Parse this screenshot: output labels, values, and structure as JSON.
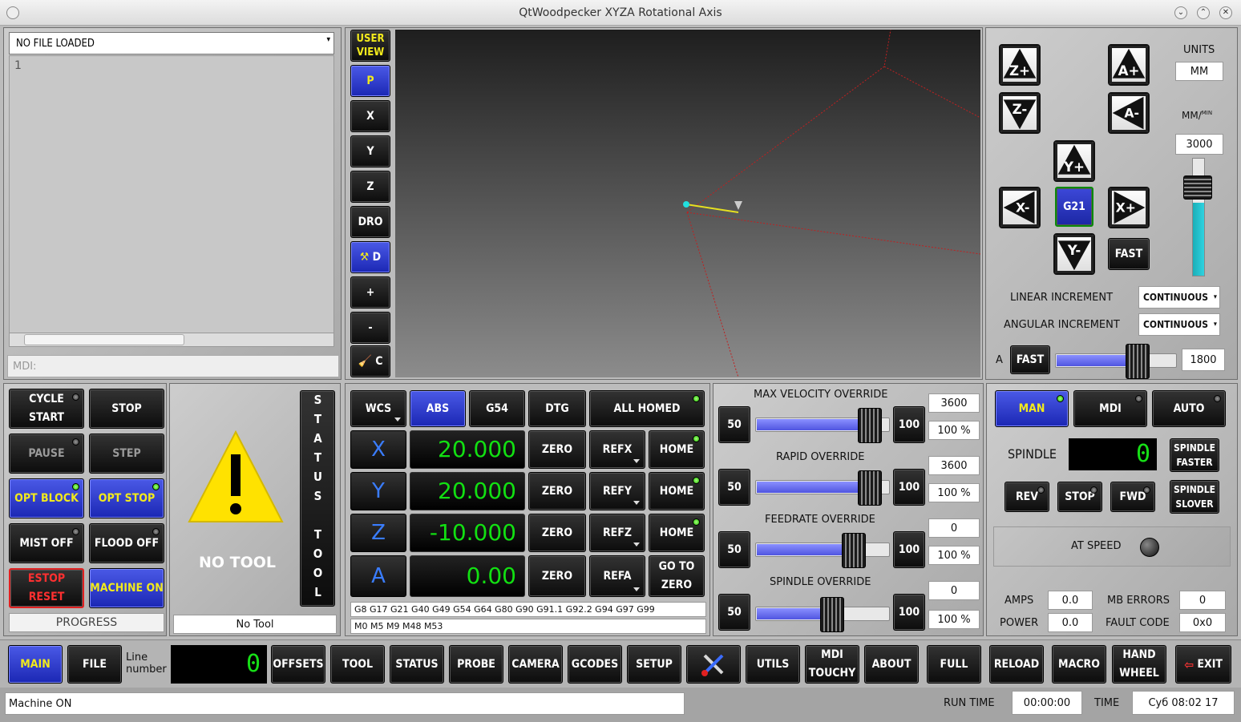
{
  "window": {
    "title": "QtWoodpecker XYZA Rotational Axis",
    "btn_min": "⌄",
    "btn_max": "⌃",
    "btn_close": "✕"
  },
  "editor": {
    "file_select": "NO FILE LOADED",
    "line_no": "1",
    "mdi_placeholder": "MDI:"
  },
  "viewer": {
    "user_view": "USER VIEW",
    "views": [
      "P",
      "X",
      "Y",
      "Z",
      "DRO",
      "D",
      "+",
      "-",
      "C"
    ]
  },
  "jog": {
    "units_label": "UNITS",
    "units": "MM",
    "feed_unit": "MM/",
    "feed_unit_sup": "MIN",
    "feed_rate": "3000",
    "g21": "G21",
    "fast": "FAST",
    "linear_inc_label": "LINEAR INCREMENT",
    "linear_inc": "CONTINUOUS",
    "angular_inc_label": "ANGULAR INCREMENT",
    "angular_inc": "CONTINUOUS",
    "a_label": "A",
    "a_fast": "FAST",
    "a_rate": "1800",
    "jog_level": 0.62,
    "a_level": 0.4,
    "labels": {
      "zp": "Z+",
      "zm": "Z-",
      "ap": "A+",
      "am": "A-",
      "yp": "Y+",
      "ym": "Y-",
      "xp": "X+",
      "xm": "X-"
    }
  },
  "controls": {
    "cycle_start": "CYCLE START",
    "stop": "STOP",
    "pause": "PAUSE",
    "step": "STEP",
    "opt_block": "OPT BLOCK",
    "opt_stop": "OPT STOP",
    "mist": "MIST OFF",
    "flood": "FLOOD OFF",
    "estop": "ESTOP RESET",
    "machine": "MACHINE ON",
    "progress": "PROGRESS"
  },
  "tool": {
    "no_tool": "NO TOOL",
    "status_tool": "STATUS TOOL",
    "tool_field": "No Tool"
  },
  "dro": {
    "wcs": "WCS",
    "abs": "ABS",
    "g54": "G54",
    "dtg": "DTG",
    "all_homed": "ALL HOMED",
    "axes": [
      {
        "name": "X",
        "value": "20.000",
        "ref": "REFX",
        "home": "HOME"
      },
      {
        "name": "Y",
        "value": "20.000",
        "ref": "REFY",
        "home": "HOME"
      },
      {
        "name": "Z",
        "value": "-10.000",
        "ref": "REFZ",
        "home": "HOME"
      },
      {
        "name": "A",
        "value": "0.00",
        "ref": "REFA",
        "home": "GO TO ZERO"
      }
    ],
    "zero": "ZERO",
    "gcodes": "G8 G17 G21 G40 G49 G54 G64 G80 G90 G91.1 G92.2 G94 G97 G99",
    "mcodes": "M0 M5 M9 M48 M53"
  },
  "overrides": [
    {
      "title": "MAX VELOCITY OVERRIDE",
      "value": "3600",
      "percent": "100 %",
      "level": 0.95,
      "low": "50",
      "high": "100"
    },
    {
      "title": "RAPID OVERRIDE",
      "value": "3600",
      "percent": "100 %",
      "level": 0.95,
      "low": "50",
      "high": "100"
    },
    {
      "title": "FEEDRATE OVERRIDE",
      "value": "0",
      "percent": "100 %",
      "level": 0.8,
      "low": "50",
      "high": "100"
    },
    {
      "title": "SPINDLE OVERRIDE",
      "value": "0",
      "percent": "100 %",
      "level": 0.6,
      "low": "50",
      "high": "100"
    }
  ],
  "spindle": {
    "man": "MAN",
    "mdi": "MDI",
    "auto": "AUTO",
    "label": "SPINDLE",
    "speed": "0",
    "faster": "SPINDLE FASTER",
    "rev": "REV",
    "stop": "STOP",
    "fwd": "FWD",
    "slower": "SPINDLE SLOVER",
    "at_speed": "AT SPEED",
    "amps_label": "AMPS",
    "amps": "0.0",
    "mb_errors_label": "MB ERRORS",
    "mb_errors": "0",
    "power_label": "POWER",
    "power": "0.0",
    "fault_label": "FAULT CODE",
    "fault": "0x0"
  },
  "tabs": {
    "main": "MAIN",
    "file": "FILE",
    "line_number_label": "Line number",
    "line_number": "0",
    "offsets": "OFFSETS",
    "tool": "TOOL",
    "status": "STATUS",
    "probe": "PROBE",
    "camera": "CAMERA",
    "gcodes": "GCODES",
    "setup": "SETUP",
    "utils": "UTILS",
    "mdi_touchy": "MDI TOUCHY",
    "about": "ABOUT",
    "full": "FULL",
    "reload": "RELOAD",
    "macro": "MACRO",
    "hand_wheel": "HAND WHEEL",
    "exit": "EXIT"
  },
  "status": {
    "message": "Machine ON",
    "run_time_label": "RUN TIME",
    "run_time": "00:00:00",
    "time_label": "TIME",
    "time": "Суб 08:02 17"
  }
}
